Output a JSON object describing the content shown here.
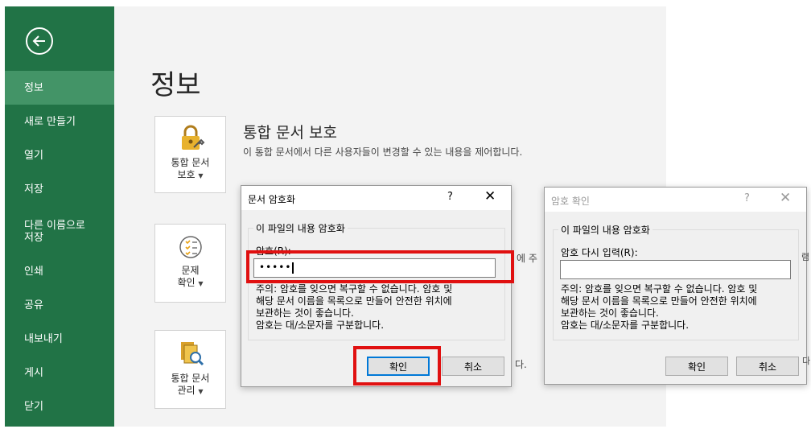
{
  "sidebar": {
    "items": [
      {
        "label": "정보",
        "active": true
      },
      {
        "label": "새로 만들기"
      },
      {
        "label": "열기"
      },
      {
        "label": "저장"
      },
      {
        "label": "다른 이름으로\n저장"
      },
      {
        "label": "인쇄"
      },
      {
        "label": "공유"
      },
      {
        "label": "내보내기"
      },
      {
        "label": "게시"
      },
      {
        "label": "닫기"
      }
    ]
  },
  "main": {
    "title": "정보",
    "protect": {
      "tile_label_line1": "통합 문서",
      "tile_label_line2": "보호",
      "heading": "통합 문서 보호",
      "description": "이 통합 문서에서 다른 사용자들이 변경할 수 있는 내용을 제어합니다."
    },
    "inspect": {
      "tile_label_line1": "문제",
      "tile_label_line2": "확인",
      "text_fragment": "에 주"
    },
    "manage": {
      "tile_label_line1": "통합 문서",
      "tile_label_line2": "관리",
      "text_fragment": "다."
    }
  },
  "encrypt_dialog": {
    "title": "문서 암호화",
    "help": "?",
    "close": "✕",
    "group_label": "이 파일의 내용 암호화",
    "password_label": "암호(R):",
    "password_value": "•••••",
    "note": "주의: 암호를 잊으면 복구할 수 없습니다. 암호 및\n해당 문서 이름을 목록으로 만들어 안전한 위치에\n보관하는 것이 좋습니다.\n암호는 대/소문자를 구분합니다.",
    "ok": "확인",
    "cancel": "취소"
  },
  "confirm_dialog": {
    "title": "암호 확인",
    "help": "?",
    "close": "✕",
    "group_label": "이 파일의 내용 암호화",
    "reenter_label": "암호 다시 입력(R):",
    "reenter_value": "",
    "note": "주의: 암호를 잊으면 복구할 수 없습니다. 암호 및\n해당 문서 이름을 목록으로 만들어 안전한 위치에\n보관하는 것이 좋습니다.\n암호는 대/소문자를 구분합니다.",
    "ok": "확인",
    "cancel": "취소",
    "edge_fragment_1": "렴",
    "edge_fragment_2": "다"
  },
  "colors": {
    "sidebar": "#217346",
    "sidebar_active": "#439467",
    "highlight": "#e01010",
    "default_button_border": "#0078d7"
  }
}
